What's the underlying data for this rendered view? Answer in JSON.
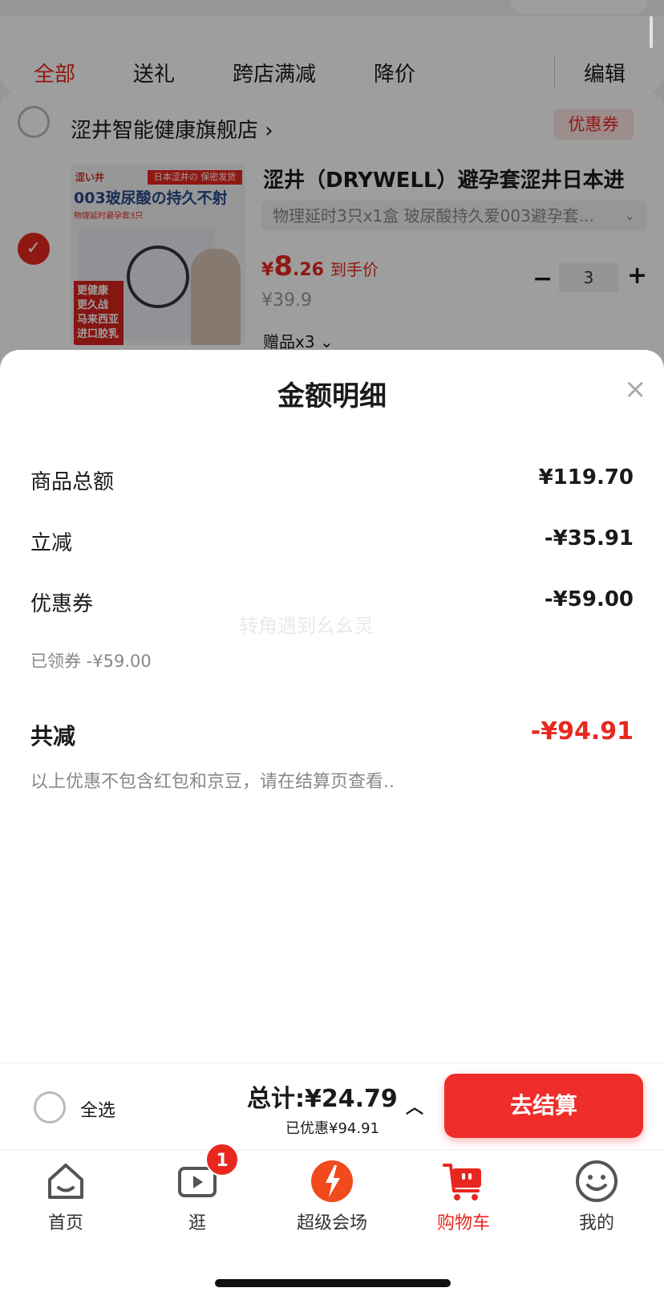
{
  "filter_tabs": [
    "全部",
    "送礼",
    "跨店满减",
    "降价"
  ],
  "edit_label": "编辑",
  "store": {
    "name": "涩井智能健康旗舰店",
    "arrow": "›",
    "coupon_tag": "优惠券"
  },
  "product": {
    "title": "涩井（DRYWELL）避孕套涩井日本进",
    "spec": "物理延时3只x1盒 玻尿酸持久爱003避孕套...",
    "price_symbol": "¥",
    "price_int": "8",
    "price_dec": ".26",
    "price_tag": "到手价",
    "orig_price": "¥39.9",
    "gift": "赠品x3",
    "quantity": "3",
    "image": {
      "brand": "涩い井",
      "band": "日本涩井の 保密发货",
      "line1": "003玻尿酸の持久不射",
      "line2": "物理延时避孕套3只",
      "redbox": "更健康 更久战 马来西亚 进口胶乳"
    }
  },
  "sheet": {
    "title": "金额明细",
    "close_icon": "×",
    "rows": [
      {
        "label": "商品总额",
        "value": "¥119.70"
      },
      {
        "label": "立减",
        "value": "-¥35.91"
      },
      {
        "label": "优惠券",
        "value": "-¥59.00",
        "sub": "已领券 -¥59.00"
      }
    ],
    "total_label": "共减",
    "total_value": "-¥94.91",
    "note": "以上优惠不包含红包和京豆，请在结算页查看..",
    "watermark": "转角遇到幺幺灵"
  },
  "checkout": {
    "select_all": "全选",
    "total": "总计:¥24.79",
    "saved": "已优惠¥94.91",
    "caret": "︿",
    "button": "去结算"
  },
  "tabbar": {
    "items": [
      {
        "label": "首页",
        "icon": "home-icon"
      },
      {
        "label": "逛",
        "icon": "video-icon"
      },
      {
        "label": "超级会场",
        "icon": "venue-icon"
      },
      {
        "label": "购物车",
        "icon": "cart-icon"
      },
      {
        "label": "我的",
        "icon": "profile-icon"
      }
    ],
    "badge": "1",
    "active_index": 3
  },
  "colors": {
    "accent": "#e8281f",
    "button": "#ef2d2a"
  }
}
